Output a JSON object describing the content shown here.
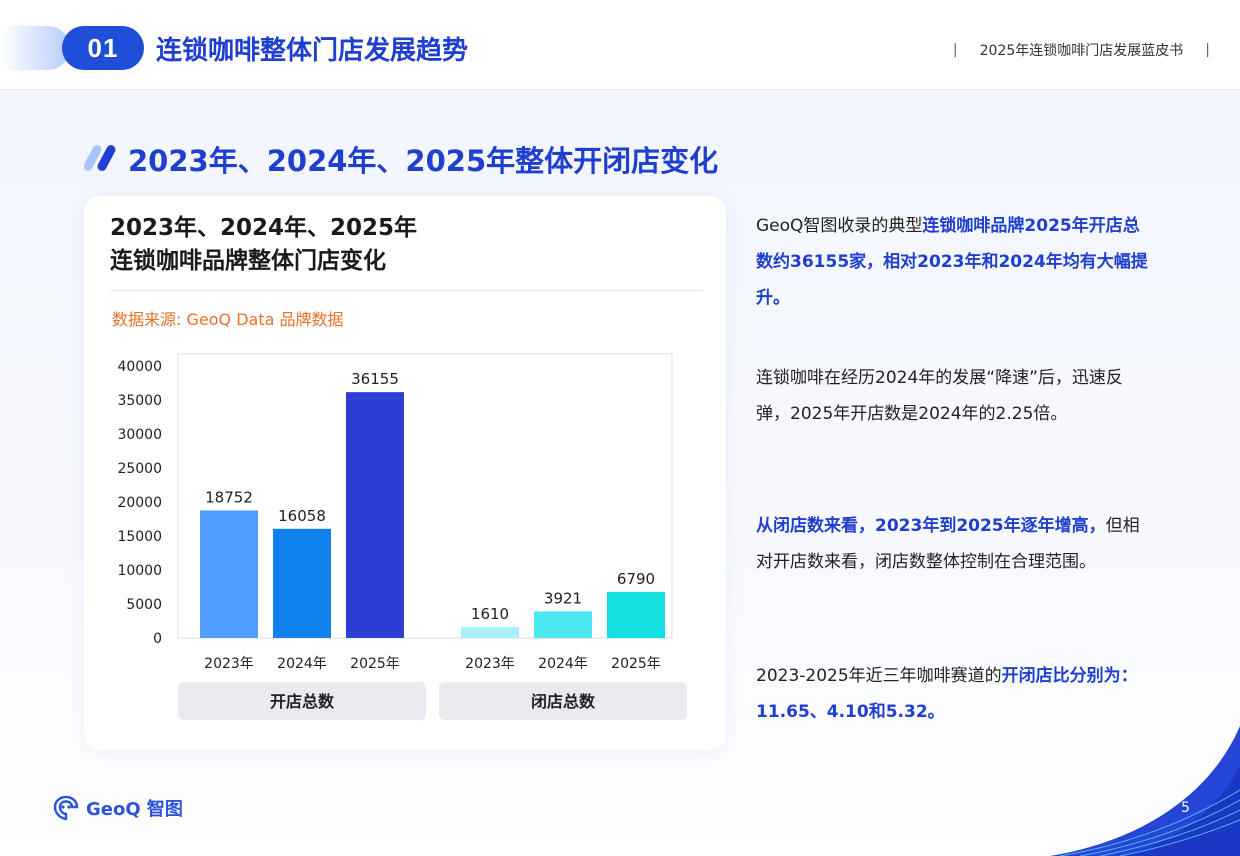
{
  "header": {
    "section_number": "01",
    "section_title": "连锁咖啡整体门店发展趋势",
    "report_name": "2025年连锁咖啡门店发展蓝皮书",
    "separator": "|"
  },
  "slide_title": "2023年、2024年、2025年整体开闭店变化",
  "card": {
    "title_line1": "2023年、2024年、2025年",
    "title_line2": "连锁咖啡品牌整体门店变化",
    "data_source": "数据来源: GeoQ Data 品牌数据"
  },
  "chart_data": {
    "type": "bar",
    "groups": [
      {
        "label": "开店总数",
        "categories": [
          "2023年",
          "2024年",
          "2025年"
        ],
        "values": [
          18752,
          16058,
          36155
        ],
        "colors": [
          "#4f9dff",
          "#1283ee",
          "#2b3fd4"
        ]
      },
      {
        "label": "闭店总数",
        "categories": [
          "2023年",
          "2024年",
          "2025年"
        ],
        "values": [
          1610,
          3921,
          6790
        ],
        "colors": [
          "#a8f0f8",
          "#4ce8f0",
          "#12dfe0"
        ]
      }
    ],
    "ylim": [
      0,
      40000
    ],
    "yticks": [
      0,
      5000,
      10000,
      15000,
      20000,
      25000,
      30000,
      35000,
      40000
    ],
    "data_labels": true,
    "grid": false
  },
  "text": {
    "p1_a": "GeoQ智图收录的典型",
    "p1_b": "连锁咖啡品牌2025年开店总数约36155家，相对2023年和2024年均有大幅提升。",
    "p2": "连锁咖啡在经历2024年的发展“降速”后，迅速反弹，2025年开店数是2024年的2.25倍。",
    "p3_a": "从闭店数来看，2023年到2025年逐年增高，",
    "p3_b": "但相对开店数来看，闭店数整体控制在合理范围。",
    "p4_a": "2023-2025年近三年咖啡赛道的",
    "p4_b": "开闭店比分别为：11.65、4.10和5.32。"
  },
  "footer": {
    "logo_text": "GeoQ 智图",
    "page_number": "5"
  },
  "colors": {
    "brand_blue": "#1f3fd0",
    "badge_blue": "#1f4fd8",
    "source_orange": "#e8702a"
  }
}
